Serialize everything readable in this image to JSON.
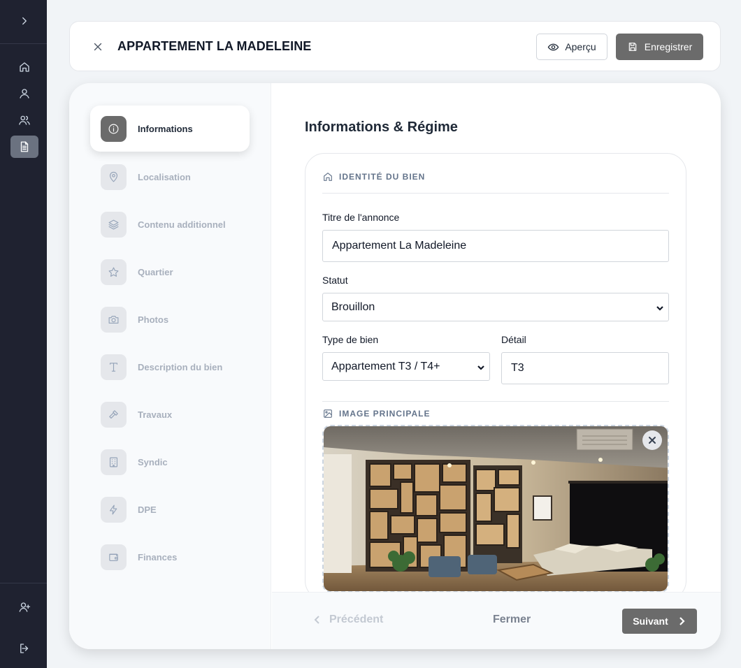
{
  "header": {
    "title": "APPARTEMENT LA MADELEINE",
    "preview_label": "Aperçu",
    "save_label": "Enregistrer"
  },
  "rail": {
    "items": [
      {
        "icon": "chevron-right-icon"
      },
      {
        "icon": "home-icon"
      },
      {
        "icon": "user-icon"
      },
      {
        "icon": "users-icon"
      },
      {
        "icon": "document-icon",
        "active": true
      },
      {
        "icon": "user-plus-icon"
      },
      {
        "icon": "logout-icon"
      }
    ]
  },
  "steps": [
    {
      "label": "Informations",
      "icon": "info-icon",
      "active": true
    },
    {
      "label": "Localisation",
      "icon": "map-pin-icon"
    },
    {
      "label": "Contenu additionnel",
      "icon": "layers-icon"
    },
    {
      "label": "Quartier",
      "icon": "star-icon"
    },
    {
      "label": "Photos",
      "icon": "camera-icon"
    },
    {
      "label": "Description du bien",
      "icon": "text-icon"
    },
    {
      "label": "Travaux",
      "icon": "hammer-icon"
    },
    {
      "label": "Syndic",
      "icon": "building-icon"
    },
    {
      "label": "DPE",
      "icon": "bolt-icon"
    },
    {
      "label": "Finances",
      "icon": "wallet-icon"
    }
  ],
  "form": {
    "section_title": "Informations & Régime",
    "identity_heading": "IDENTITÉ DU BIEN",
    "title_label": "Titre de l'annonce",
    "title_value": "Appartement La Madeleine",
    "status_label": "Statut",
    "status_value": "Brouillon",
    "type_label": "Type de bien",
    "type_value": "Appartement T3 / T4+",
    "detail_label": "Détail",
    "detail_value": "T3",
    "image_heading": "IMAGE PRINCIPALE"
  },
  "footer": {
    "prev_label": "Précédent",
    "close_label": "Fermer",
    "next_label": "Suivant"
  }
}
